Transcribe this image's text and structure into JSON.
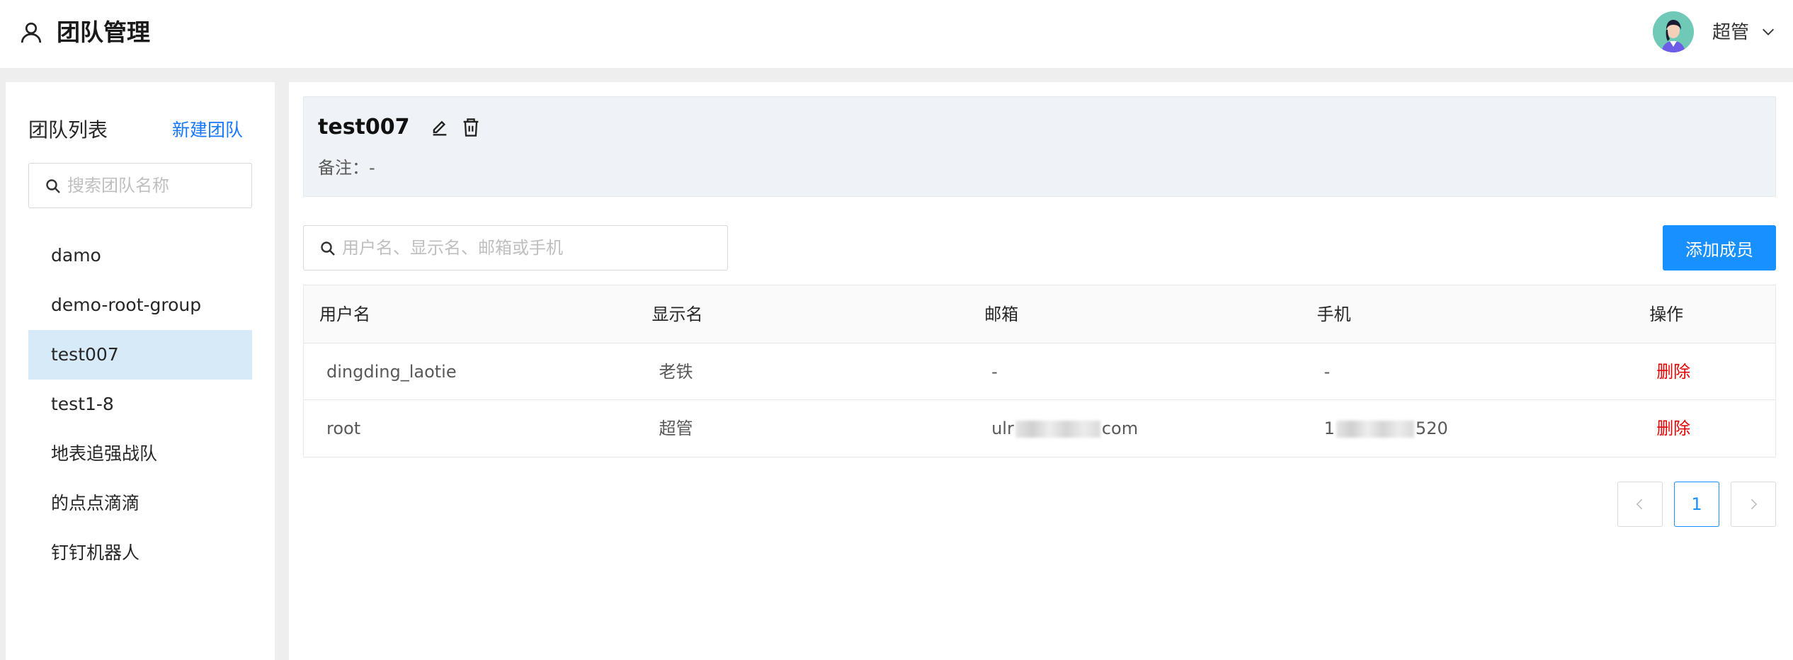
{
  "header": {
    "title": "团队管理",
    "username": "超管"
  },
  "sidebar": {
    "list_title": "团队列表",
    "new_team": "新建团队",
    "search_placeholder": "搜索团队名称",
    "teams": [
      {
        "label": "damo"
      },
      {
        "label": "demo-root-group"
      },
      {
        "label": "test007"
      },
      {
        "label": "test1-8"
      },
      {
        "label": "地表追强战队"
      },
      {
        "label": "的点点滴滴"
      },
      {
        "label": "钉钉机器人"
      }
    ],
    "selected": "test007"
  },
  "team": {
    "name": "test007",
    "remark": "备注：-"
  },
  "members": {
    "search_placeholder": "用户名、显示名、邮箱或手机",
    "add_button": "添加成员",
    "columns": [
      "用户名",
      "显示名",
      "邮箱",
      "手机",
      "操作"
    ],
    "rows": [
      {
        "username": "dingding_laotie",
        "display": "老铁",
        "email": "-",
        "phone": "-",
        "action": "删除"
      },
      {
        "username": "root",
        "display": "超管",
        "email_prefix": "ulr",
        "email_suffix": "com",
        "phone_prefix": "1",
        "phone_suffix": "520",
        "action": "删除"
      }
    ]
  },
  "pagination": {
    "current": "1"
  },
  "colors": {
    "primary": "#1890ff",
    "danger": "#e60000",
    "selected_bg": "#d6eaf7"
  }
}
